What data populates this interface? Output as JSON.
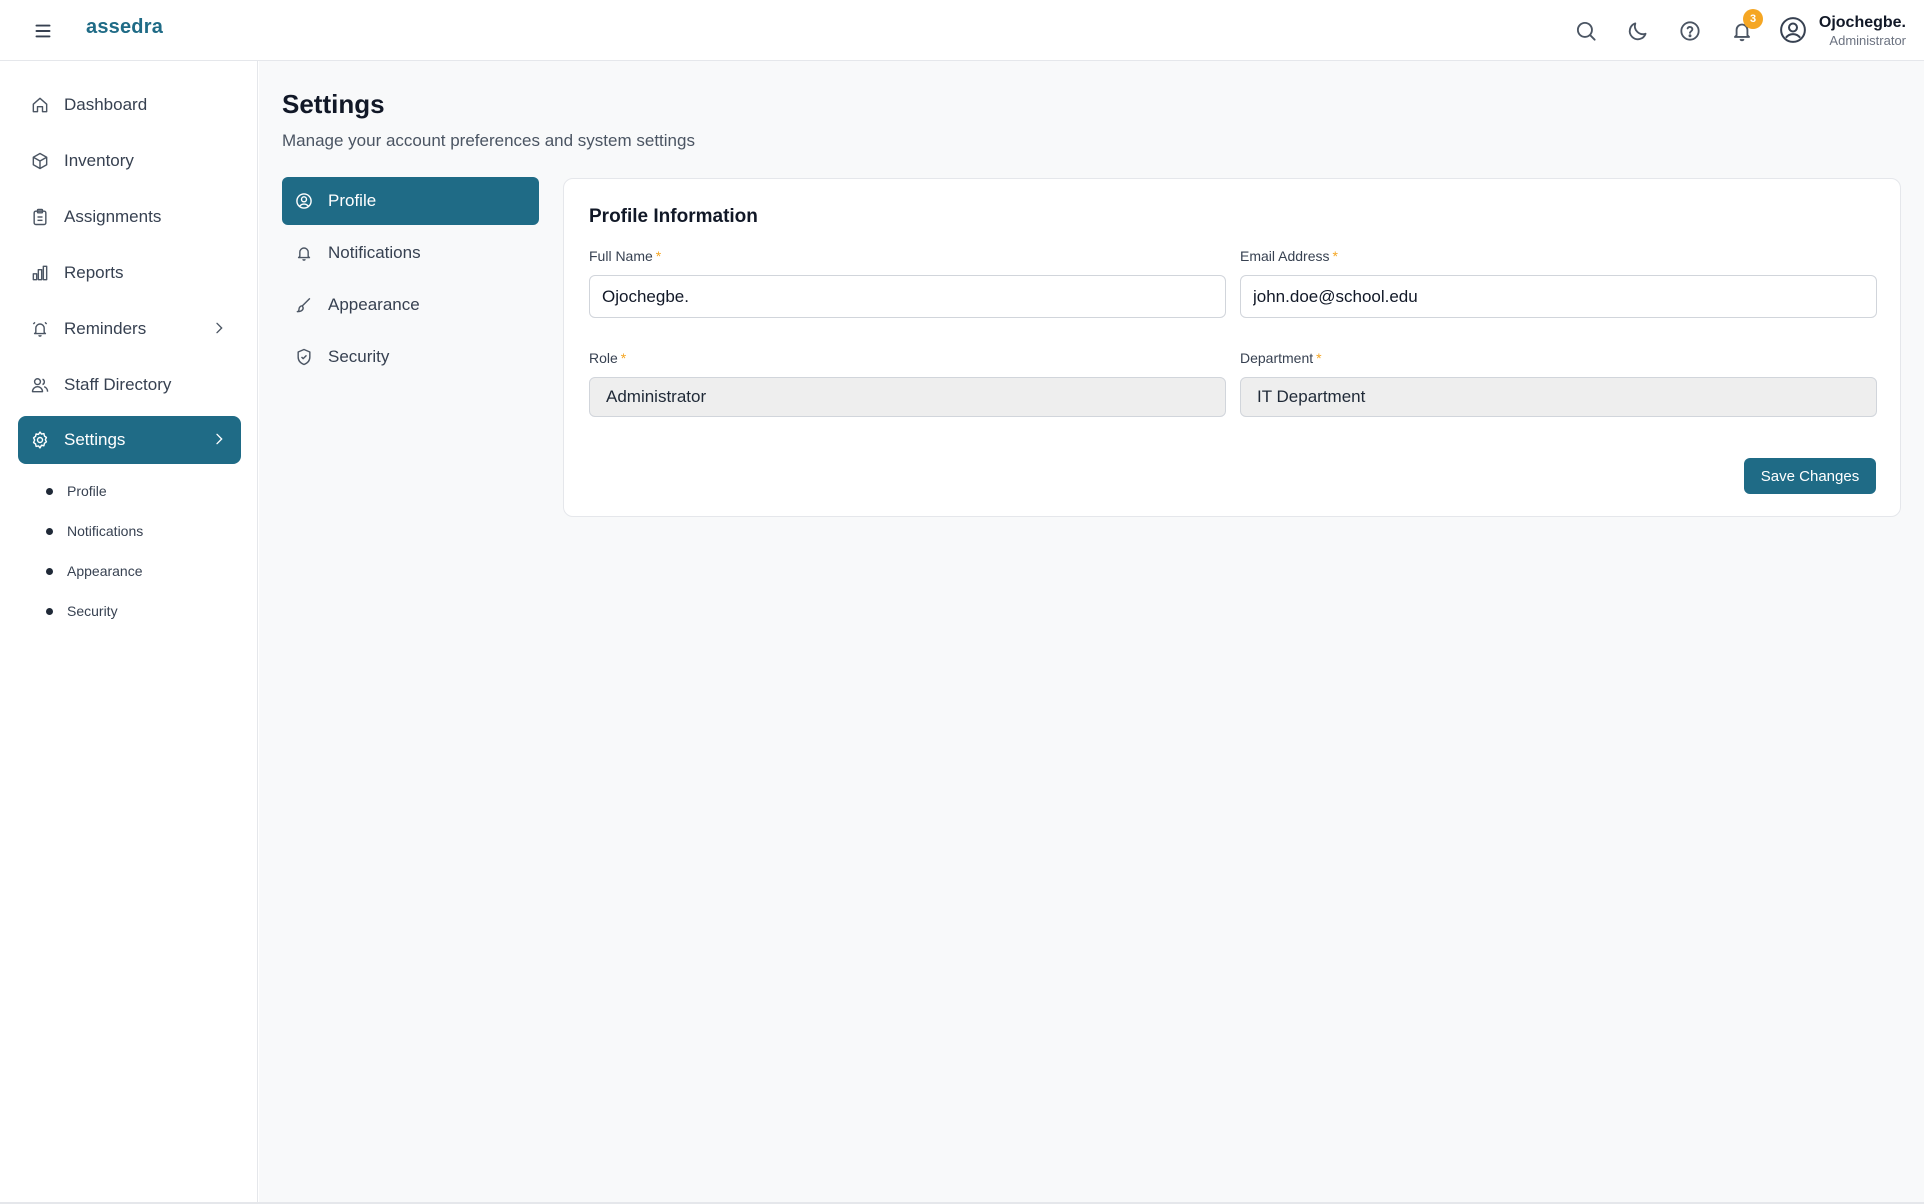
{
  "app": {
    "logo": "assedra"
  },
  "topbar": {
    "notification_count": "3",
    "user": {
      "name": "Ojochegbe.",
      "role": "Administrator"
    },
    "icons": [
      "search-icon",
      "moon-icon",
      "help-icon",
      "bell-icon",
      "user-circle-icon"
    ]
  },
  "sidebar": {
    "items": [
      {
        "label": "Dashboard",
        "icon": "home-icon"
      },
      {
        "label": "Inventory",
        "icon": "box-icon"
      },
      {
        "label": "Assignments",
        "icon": "clipboard-icon"
      },
      {
        "label": "Reports",
        "icon": "bar-chart-icon"
      },
      {
        "label": "Reminders",
        "icon": "alarm-icon"
      },
      {
        "label": "Staff Directory",
        "icon": "users-icon"
      },
      {
        "label": "Settings",
        "icon": "gear-icon",
        "active": true
      }
    ],
    "settings_sub": [
      "Profile",
      "Notifications",
      "Appearance",
      "Security"
    ]
  },
  "page": {
    "title": "Settings",
    "subtitle": "Manage your account preferences and system settings"
  },
  "tabs": [
    {
      "label": "Profile",
      "icon": "user-circle-icon",
      "active": true
    },
    {
      "label": "Notifications",
      "icon": "bell-icon"
    },
    {
      "label": "Appearance",
      "icon": "brush-icon"
    },
    {
      "label": "Security",
      "icon": "shield-icon"
    }
  ],
  "profile": {
    "title": "Profile Information",
    "full_name_label": "Full Name",
    "full_name_value": "Ojochegbe.",
    "email_label": "Email Address",
    "email_value": "john.doe@school.edu",
    "role_label": "Role",
    "role_value": "Administrator",
    "department_label": "Department",
    "department_value": "IT Department",
    "required_marker": "*",
    "save_label": "Save Changes"
  },
  "colors": {
    "accent": "#1f6b86",
    "badge": "#f5a623",
    "background": "#f8f9fa"
  }
}
